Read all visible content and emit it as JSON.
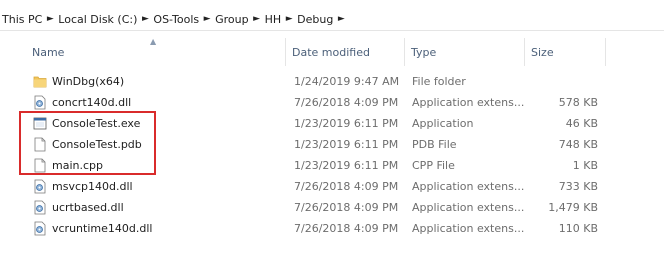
{
  "breadcrumb": [
    {
      "label": "This PC"
    },
    {
      "label": "Local Disk (C:)"
    },
    {
      "label": "OS-Tools"
    },
    {
      "label": "Group"
    },
    {
      "label": "HH"
    },
    {
      "label": "Debug"
    }
  ],
  "columns": {
    "name": "Name",
    "date": "Date modified",
    "type": "Type",
    "size": "Size"
  },
  "files": [
    {
      "name": "WinDbg(x64)",
      "date": "1/24/2019 9:47 AM",
      "type": "File folder",
      "size": "",
      "icon": "folder-icon"
    },
    {
      "name": "concrt140d.dll",
      "date": "7/26/2018 4:09 PM",
      "type": "Application extens...",
      "size": "578 KB",
      "icon": "dll-icon"
    },
    {
      "name": "ConsoleTest.exe",
      "date": "1/23/2019 6:11 PM",
      "type": "Application",
      "size": "46 KB",
      "icon": "exe-icon"
    },
    {
      "name": "ConsoleTest.pdb",
      "date": "1/23/2019 6:11 PM",
      "type": "PDB File",
      "size": "748 KB",
      "icon": "file-icon"
    },
    {
      "name": "main.cpp",
      "date": "1/23/2019 6:11 PM",
      "type": "CPP File",
      "size": "1 KB",
      "icon": "file-icon"
    },
    {
      "name": "msvcp140d.dll",
      "date": "7/26/2018 4:09 PM",
      "type": "Application extens...",
      "size": "733 KB",
      "icon": "dll-icon"
    },
    {
      "name": "ucrtbased.dll",
      "date": "7/26/2018 4:09 PM",
      "type": "Application extens...",
      "size": "1,479 KB",
      "icon": "dll-icon"
    },
    {
      "name": "vcruntime140d.dll",
      "date": "7/26/2018 4:09 PM",
      "type": "Application extens...",
      "size": "110 KB",
      "icon": "dll-icon"
    }
  ],
  "colors": {
    "highlight": "#d92b2b",
    "header_text": "#4c607a",
    "secondary_text": "#6d6d6d",
    "folder": "#f2c55c"
  }
}
